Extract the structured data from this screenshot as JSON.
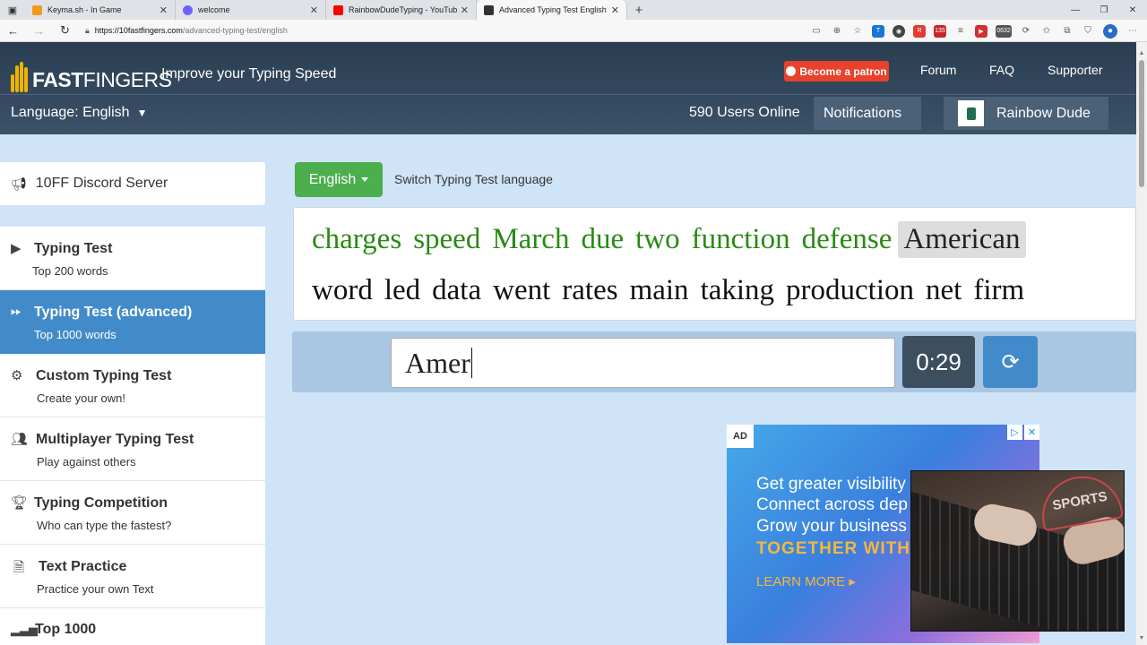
{
  "browser": {
    "tabs": [
      {
        "title": "Keyma.sh - In Game",
        "color": "#f29a1e"
      },
      {
        "title": "welcome",
        "color": "#6c63ff"
      },
      {
        "title": "RainbowDudeTyping - YouTube",
        "color": "#ff0000"
      },
      {
        "title": "Advanced Typing Test English",
        "color": "#333333"
      }
    ],
    "url_host": "https://10fastfingers.com",
    "url_path": "/advanced-typing-test/english",
    "extension_badges": [
      "135",
      "0632"
    ]
  },
  "header": {
    "logo_prefix": "10",
    "logo_fast": "FAST",
    "logo_fingers": "FINGERS",
    "tagline": "Improve your Typing Speed",
    "patron_label": "Become a patron",
    "nav": [
      "Forum",
      "FAQ",
      "Supporter"
    ],
    "language_label": "Language: English",
    "users_online": "590 Users Online",
    "notifications": "Notifications",
    "username": "Rainbow Dude"
  },
  "sidebar": {
    "discord": "10FF Discord Server",
    "items": [
      {
        "title": "Typing Test",
        "subtitle": "Top 200 words",
        "icon": "play-icon"
      },
      {
        "title": "Typing Test (advanced)",
        "subtitle": "Top 1000 words",
        "icon": "fast-forward-icon"
      },
      {
        "title": "Custom Typing Test",
        "subtitle": "Create your own!",
        "icon": "gears-icon"
      },
      {
        "title": "Multiplayer Typing Test",
        "subtitle": "Play against others",
        "icon": "users-icon"
      },
      {
        "title": "Typing Competition",
        "subtitle": "Who can type the fastest?",
        "icon": "trophy-icon"
      },
      {
        "title": "Text Practice",
        "subtitle": "Practice your own Text",
        "icon": "document-icon"
      },
      {
        "title": "Top 1000",
        "subtitle": "",
        "icon": "bar-chart-icon"
      }
    ]
  },
  "test": {
    "language_button": "English",
    "switch_label": "Switch Typing Test language",
    "line1": [
      {
        "word": "charges",
        "state": "done"
      },
      {
        "word": "speed",
        "state": "done"
      },
      {
        "word": "March",
        "state": "done"
      },
      {
        "word": "due",
        "state": "done"
      },
      {
        "word": "two",
        "state": "done"
      },
      {
        "word": "function",
        "state": "done"
      },
      {
        "word": "defense",
        "state": "done"
      },
      {
        "word": "American",
        "state": "cur"
      }
    ],
    "line2": [
      "word",
      "led",
      "data",
      "went",
      "rates",
      "main",
      "taking",
      "production",
      "net",
      "firm"
    ],
    "input_value": "Amer",
    "timer": "0:29"
  },
  "ad": {
    "label": "AD",
    "lines": [
      "Get greater visibility",
      "Connect across dep",
      "Grow your business",
      "TOGETHER WITH"
    ],
    "cta": "LEARN MORE ▸"
  },
  "colors": {
    "header_bg": "#2a3e52",
    "active_item": "#428bca",
    "correct_word": "#2a8a14",
    "patron": "#e8412c"
  }
}
